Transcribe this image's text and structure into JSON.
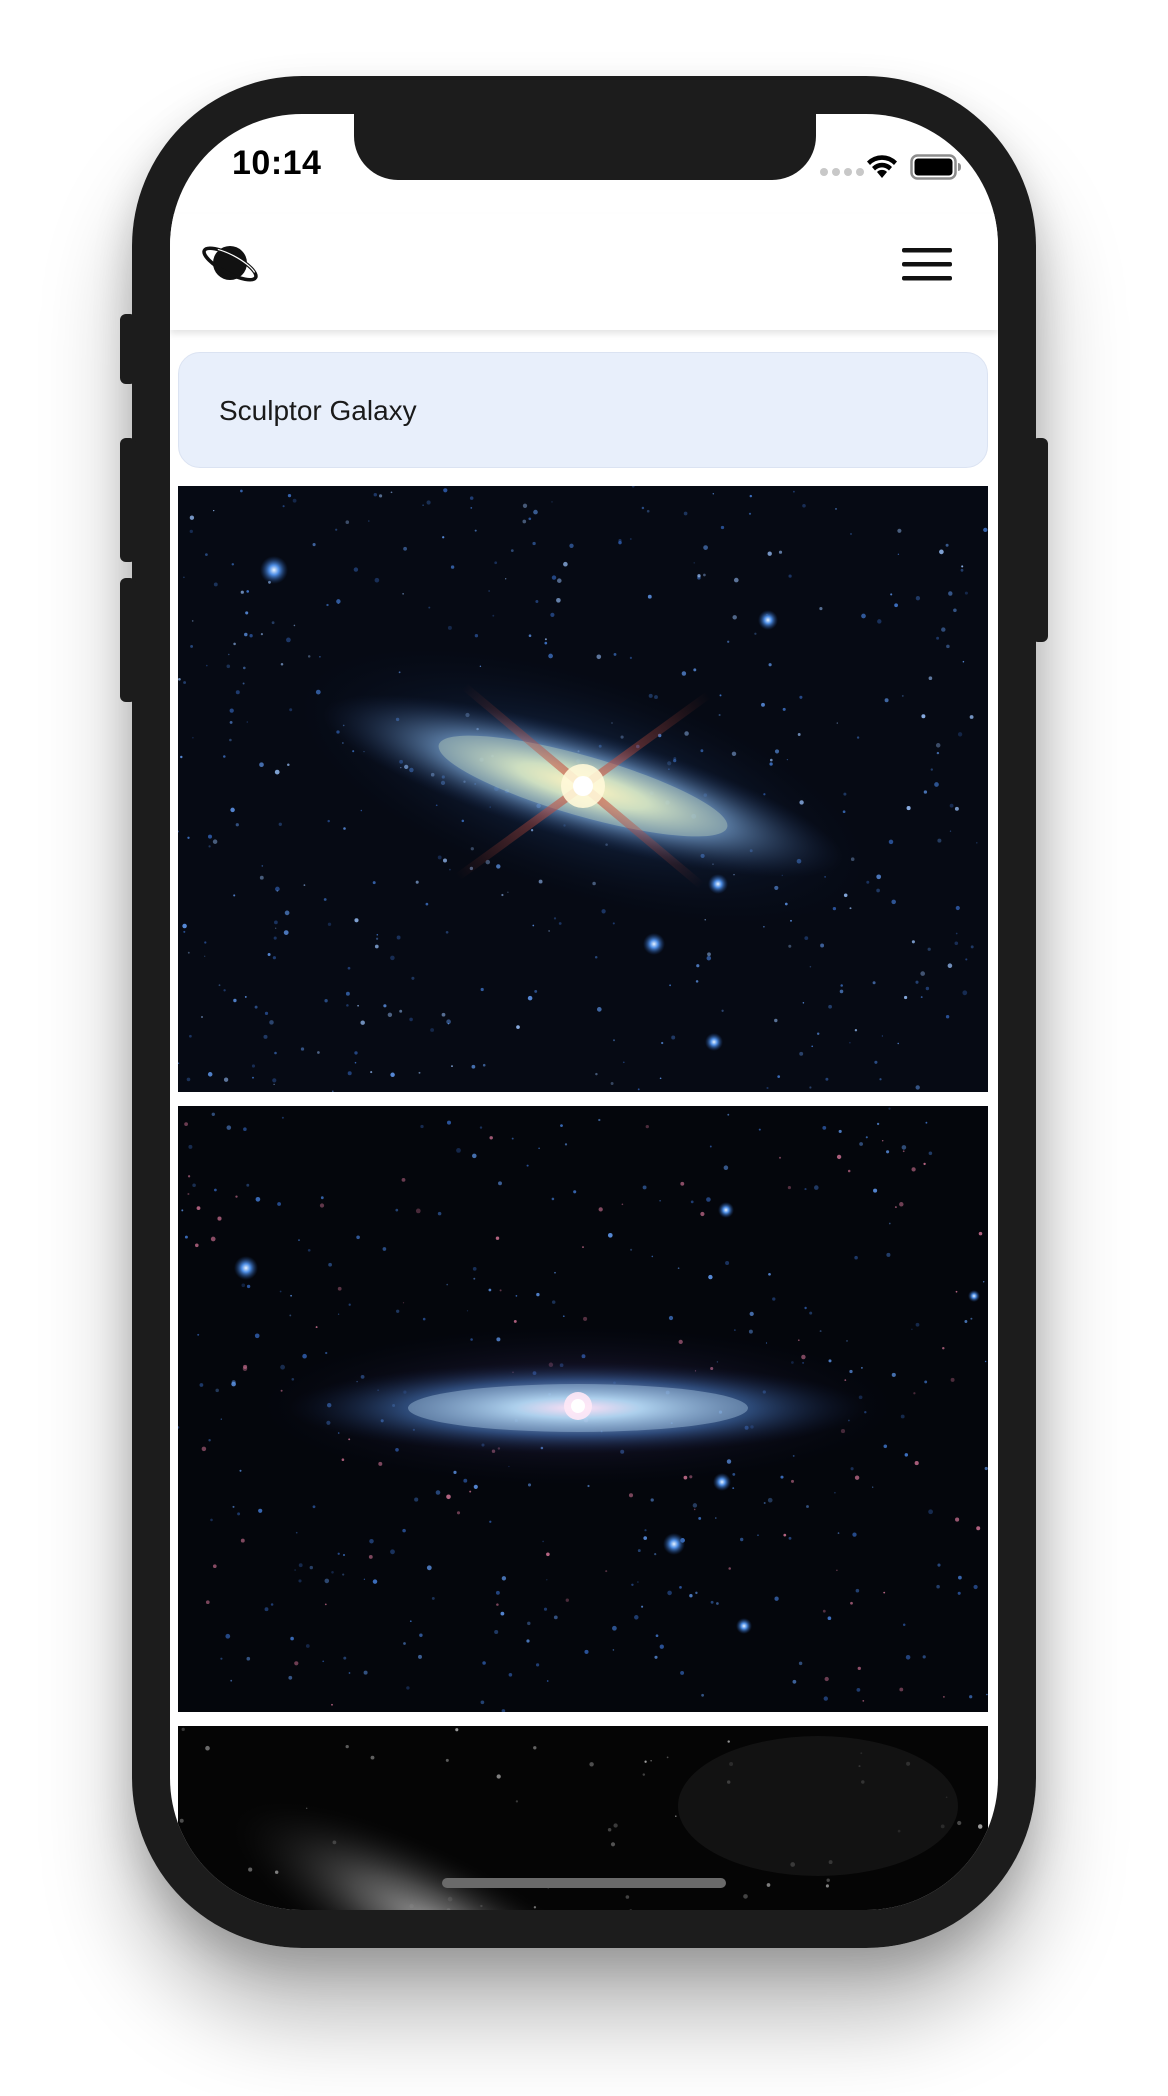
{
  "status_bar": {
    "time": "10:14",
    "icons": [
      "signal-icon",
      "wifi-icon",
      "battery-icon"
    ]
  },
  "header": {
    "logo_icon": "planet-icon",
    "menu_icon": "hamburger-menu-icon"
  },
  "content": {
    "title": "Sculptor Galaxy",
    "images": [
      {
        "alt": "galaxy-image-infrared-tilted"
      },
      {
        "alt": "galaxy-image-infrared-edge-on"
      },
      {
        "alt": "galaxy-image-monochrome"
      }
    ]
  },
  "colors": {
    "title_card_bg": "#e8effb",
    "device_frame": "#1c1c1c",
    "space_bg": "#05070d"
  }
}
